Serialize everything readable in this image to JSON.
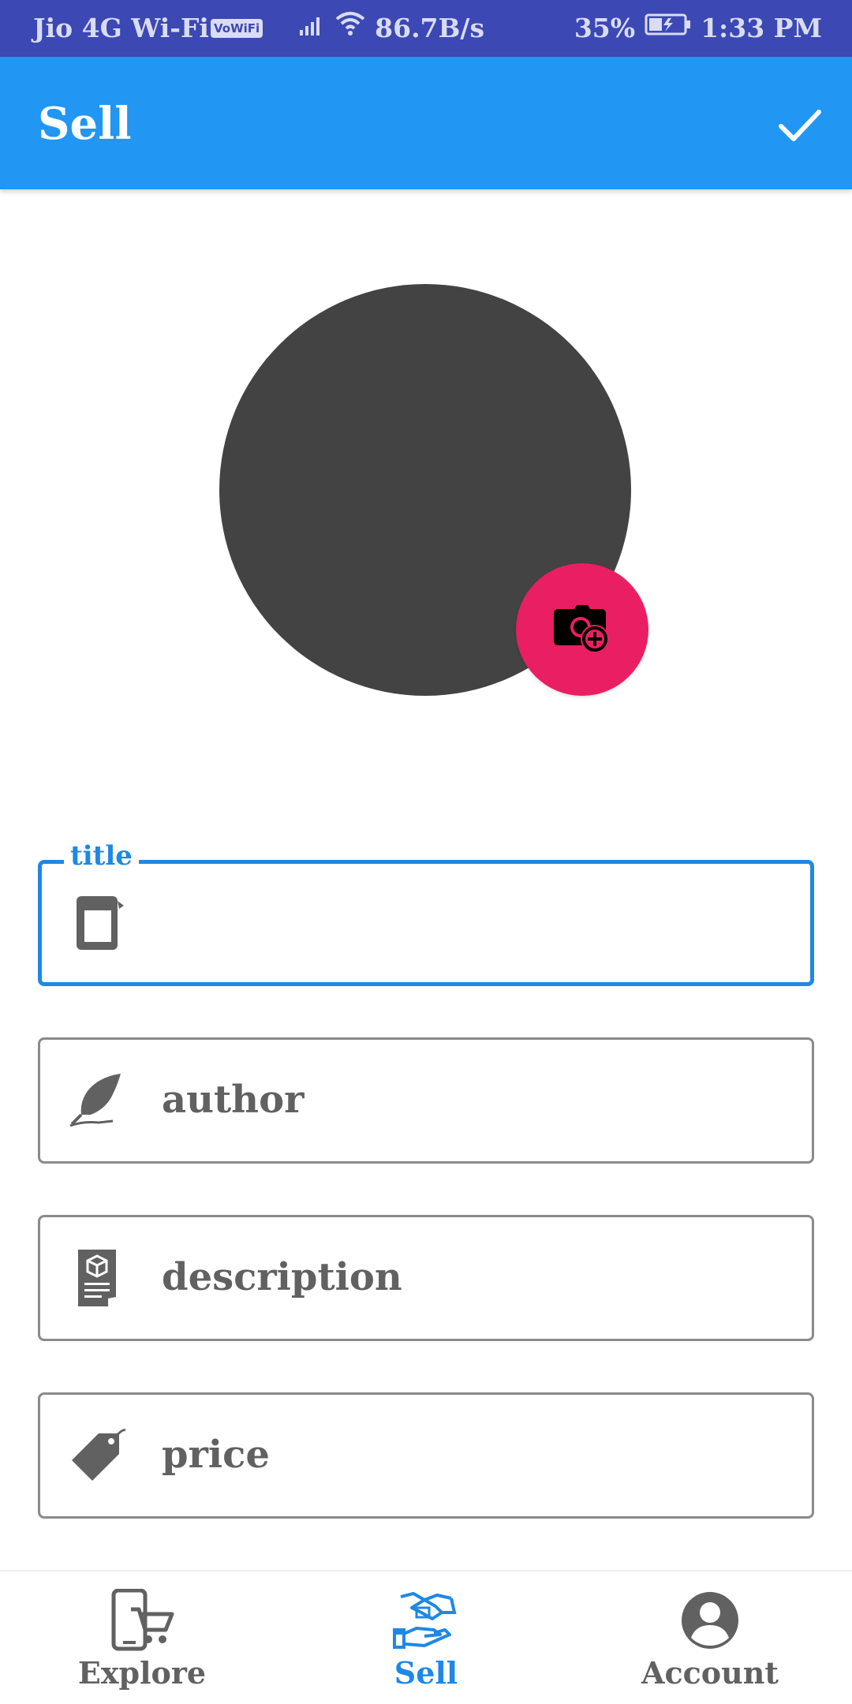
{
  "status_bar": {
    "carrier": "Jio 4G Wi-Fi",
    "vowifi_badge": "VoWiFi",
    "speed": "86.7B/s",
    "battery": "35%",
    "time": "1:33 PM"
  },
  "app_bar": {
    "title": "Sell",
    "action_icon": "check-icon"
  },
  "photo": {
    "add_photo_icon": "camera-plus-icon"
  },
  "form": {
    "fields": [
      {
        "label": "title",
        "value": "",
        "icon": "book-icon",
        "focused": true
      },
      {
        "placeholder": "author",
        "icon": "quill-icon"
      },
      {
        "placeholder": "description",
        "icon": "document-icon"
      },
      {
        "placeholder": "price",
        "icon": "price-tag-icon"
      }
    ]
  },
  "bottom_nav": {
    "items": [
      {
        "label": "Explore",
        "icon": "phone-cart-icon",
        "active": false
      },
      {
        "label": "Sell",
        "icon": "handshake-icon",
        "active": true
      },
      {
        "label": "Account",
        "icon": "account-icon",
        "active": false
      }
    ]
  },
  "colors": {
    "status_bar": "#3c48b3",
    "app_bar": "#2196f3",
    "accent": "#1e88e5",
    "fab": "#e91e63",
    "avatar": "#434343",
    "muted_text": "#616161"
  }
}
